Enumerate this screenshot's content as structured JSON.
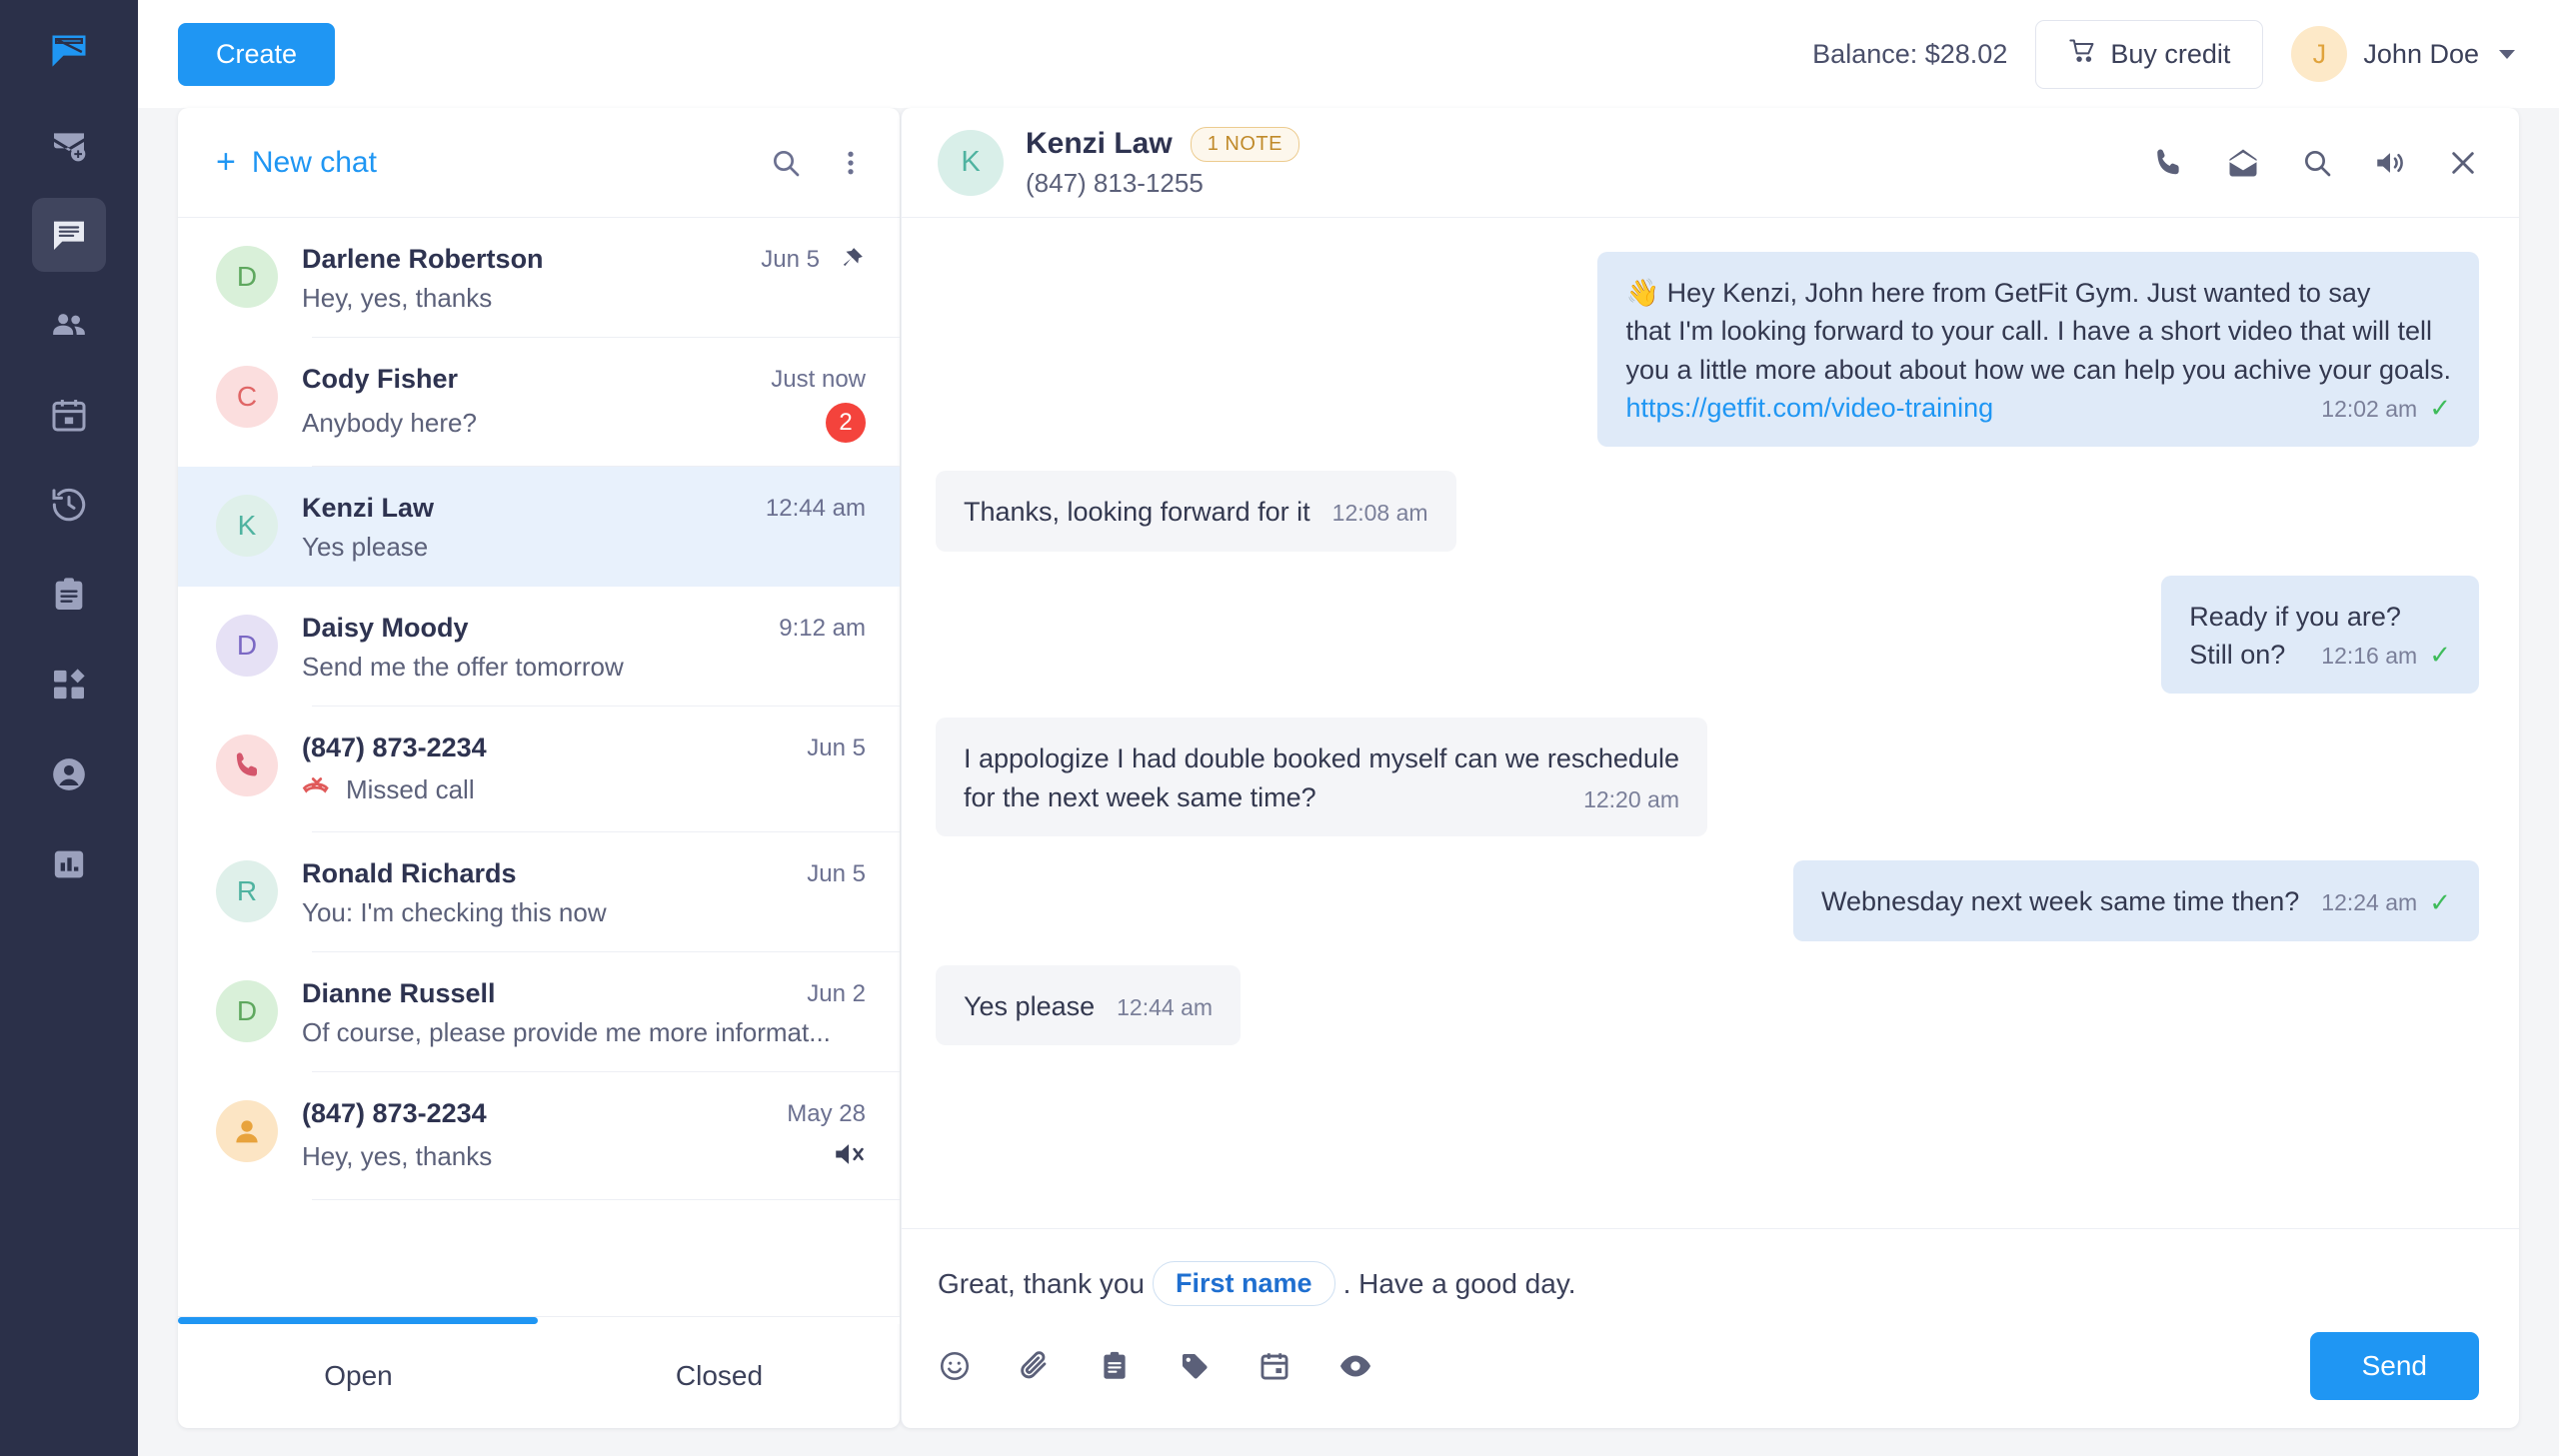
{
  "rail": {
    "logo_icon": "chat-logo-icon",
    "items": [
      {
        "icon": "mail-add-icon",
        "name": "sidebar-item-new-message",
        "active": false
      },
      {
        "icon": "chat-lines-icon",
        "name": "sidebar-item-inbox",
        "active": true
      },
      {
        "icon": "people-icon",
        "name": "sidebar-item-contacts",
        "active": false
      },
      {
        "icon": "calendar-icon",
        "name": "sidebar-item-calendar",
        "active": false
      },
      {
        "icon": "history-icon",
        "name": "sidebar-item-history",
        "active": false
      },
      {
        "icon": "clipboard-icon",
        "name": "sidebar-item-templates",
        "active": false
      },
      {
        "icon": "apps-icon",
        "name": "sidebar-item-integrations",
        "active": false
      },
      {
        "icon": "account-icon",
        "name": "sidebar-item-account",
        "active": false
      },
      {
        "icon": "bar-chart-icon",
        "name": "sidebar-item-reports",
        "active": false
      }
    ]
  },
  "topbar": {
    "create_label": "Create",
    "balance_label": "Balance: $28.02",
    "buy_credit_label": "Buy credit",
    "cart_icon": "shopping-cart-icon",
    "user_initial": "J",
    "user_name": "John Doe"
  },
  "chat_list": {
    "new_chat_label": "New chat",
    "new_chat_plus": "+",
    "search_icon": "search-icon",
    "more_icon": "more-vertical-icon",
    "items": [
      {
        "initial": "D",
        "avatar_bg": "#d9f0d9",
        "avatar_fg": "#5fa85f",
        "name": "Darlene Robertson",
        "time": "Jun 5",
        "message": "Hey, yes, thanks",
        "pinned": true,
        "unread": "",
        "muted": false,
        "missed": false,
        "selected": false
      },
      {
        "initial": "C",
        "avatar_bg": "#fbdede",
        "avatar_fg": "#e06666",
        "name": "Cody Fisher",
        "time": "Just now",
        "message": "Anybody here?",
        "pinned": false,
        "unread": "2",
        "muted": false,
        "missed": false,
        "selected": false
      },
      {
        "initial": "K",
        "avatar_bg": "#dff0ea",
        "avatar_fg": "#4fb3a0",
        "name": "Kenzi Law",
        "time": "12:44 am",
        "message": "Yes please",
        "pinned": false,
        "unread": "",
        "muted": false,
        "missed": false,
        "selected": true
      },
      {
        "initial": "D",
        "avatar_bg": "#e6e1f5",
        "avatar_fg": "#7b68c4",
        "name": "Daisy Moody",
        "time": "9:12 am",
        "message": "Send me the offer tomorrow",
        "pinned": false,
        "unread": "",
        "muted": false,
        "missed": false,
        "selected": false
      },
      {
        "initial": "",
        "avatar_bg": "#fbdede",
        "avatar_fg": "#d4566c",
        "avatar_icon": "phone-icon",
        "name": "(847) 873-2234",
        "time": "Jun 5",
        "message": "Missed call",
        "pinned": false,
        "unread": "",
        "muted": false,
        "missed": true,
        "selected": false
      },
      {
        "initial": "R",
        "avatar_bg": "#dff0ea",
        "avatar_fg": "#4fb3a0",
        "name": "Ronald Richards",
        "time": "Jun 5",
        "message": "You: I'm checking this now",
        "pinned": false,
        "unread": "",
        "muted": false,
        "missed": false,
        "selected": false
      },
      {
        "initial": "D",
        "avatar_bg": "#d9f0d9",
        "avatar_fg": "#5fa85f",
        "name": "Dianne Russell",
        "time": "Jun 2",
        "message": "Of course, please provide me more informat...",
        "pinned": false,
        "unread": "",
        "muted": false,
        "missed": false,
        "selected": false
      },
      {
        "initial": "",
        "avatar_bg": "#fce5c4",
        "avatar_fg": "#e8a33d",
        "avatar_icon": "person-icon",
        "name": "(847) 873-2234",
        "time": "May 28",
        "message": "Hey, yes, thanks",
        "pinned": false,
        "unread": "",
        "muted": true,
        "missed": false,
        "selected": false
      }
    ],
    "tabs": [
      {
        "label": "Open",
        "active": true
      },
      {
        "label": "Closed",
        "active": false
      }
    ]
  },
  "conversation": {
    "avatar_initial": "K",
    "name": "Kenzi Law",
    "note_badge": "1 NOTE",
    "phone": "(847) 813-1255",
    "header_icons": [
      {
        "icon": "phone-icon",
        "name": "call-button"
      },
      {
        "icon": "mail-open-icon",
        "name": "mark-unread-button"
      },
      {
        "icon": "search-icon",
        "name": "search-conversation-button"
      },
      {
        "icon": "volume-icon",
        "name": "mute-button"
      },
      {
        "icon": "close-icon",
        "name": "close-conversation-button"
      }
    ],
    "messages": [
      {
        "dir": "out",
        "layout": "block",
        "lines": [
          "👋 Hey Kenzi, John here from GetFit Gym. Just wanted to say",
          "that I'm looking forward to your call. I have a short video that will tell",
          "you a little more about about how we can help you achive your goals."
        ],
        "link": "https://getfit.com/video-training",
        "time": "12:02 am",
        "delivered": true
      },
      {
        "dir": "in",
        "layout": "inline",
        "text": "Thanks, looking forward for it",
        "time": "12:08 am",
        "delivered": false
      },
      {
        "dir": "out",
        "layout": "two-line",
        "lines": [
          "Ready if you are?",
          "Still on?"
        ],
        "time": "12:16 am",
        "delivered": true
      },
      {
        "dir": "in",
        "layout": "wrap",
        "lines": [
          "I appologize I had double booked myself can we reschedule",
          "for the next week same time?"
        ],
        "time": "12:20 am",
        "delivered": false
      },
      {
        "dir": "out",
        "layout": "inline",
        "text": "Webnesday next week same time then?",
        "time": "12:24 am",
        "delivered": true
      },
      {
        "dir": "in",
        "layout": "inline",
        "text": "Yes please",
        "time": "12:44 am",
        "delivered": false
      }
    ]
  },
  "composer": {
    "text_before": "Great, thank you",
    "variable_chip": "First name",
    "text_after": ". Have a good day.",
    "tools": [
      {
        "icon": "emoji-icon",
        "name": "emoji-button"
      },
      {
        "icon": "paperclip-icon",
        "name": "attachment-button"
      },
      {
        "icon": "clipboard-icon",
        "name": "template-button"
      },
      {
        "icon": "tag-icon",
        "name": "tag-button"
      },
      {
        "icon": "calendar-icon",
        "name": "schedule-button"
      },
      {
        "icon": "eye-icon",
        "name": "preview-button"
      }
    ],
    "send_label": "Send"
  },
  "colors": {
    "accent": "#1f96f3",
    "rail_bg": "#2b3049",
    "unread_badge": "#f4433c",
    "tick_green": "#3fbc5b",
    "bubble_out": "#dfeaf8",
    "bubble_in": "#f4f5f8",
    "selected_row": "#e8f1fc"
  }
}
